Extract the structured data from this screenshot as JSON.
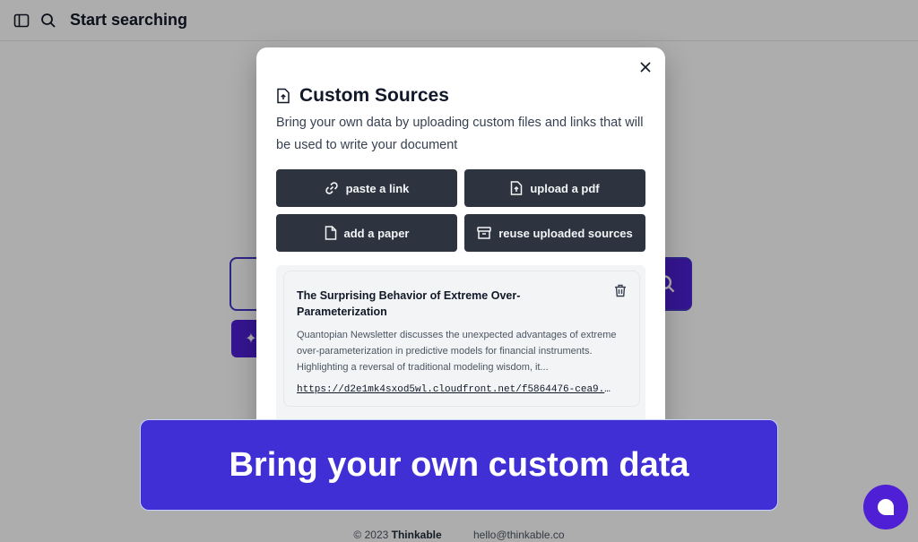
{
  "topbar": {
    "title": "Start searching",
    "sidebar_icon": "sidebar-toggle-icon",
    "search_icon": "search-icon"
  },
  "footer": {
    "copyright_prefix": "© 2023",
    "brand": "Thinkable",
    "email": "hello@thinkable.co"
  },
  "modal": {
    "title": "Custom Sources",
    "description": "Bring your own data by uploading custom files and links that will be used to write your document",
    "buttons": {
      "paste_link": "paste a link",
      "upload_pdf": "upload a pdf",
      "add_paper": "add a paper",
      "reuse_sources": "reuse uploaded sources"
    },
    "sources": [
      {
        "title": "The Surprising Behavior of Extreme Over-Parameterization",
        "description": "Quantopian Newsletter discusses the unexpected advantages of extreme over-parameterization in predictive models for financial instruments. Highlighting a reversal of traditional modeling wisdom, it...",
        "link": "https://d2e1mk4sxod5wl.cloudfront.net/f5864476-cea9..."
      }
    ]
  },
  "banner": {
    "text": "Bring your own custom data"
  },
  "colors": {
    "accent": "#4f1fd6",
    "banner": "#3f2fd5",
    "button_dark": "#2d333f"
  }
}
